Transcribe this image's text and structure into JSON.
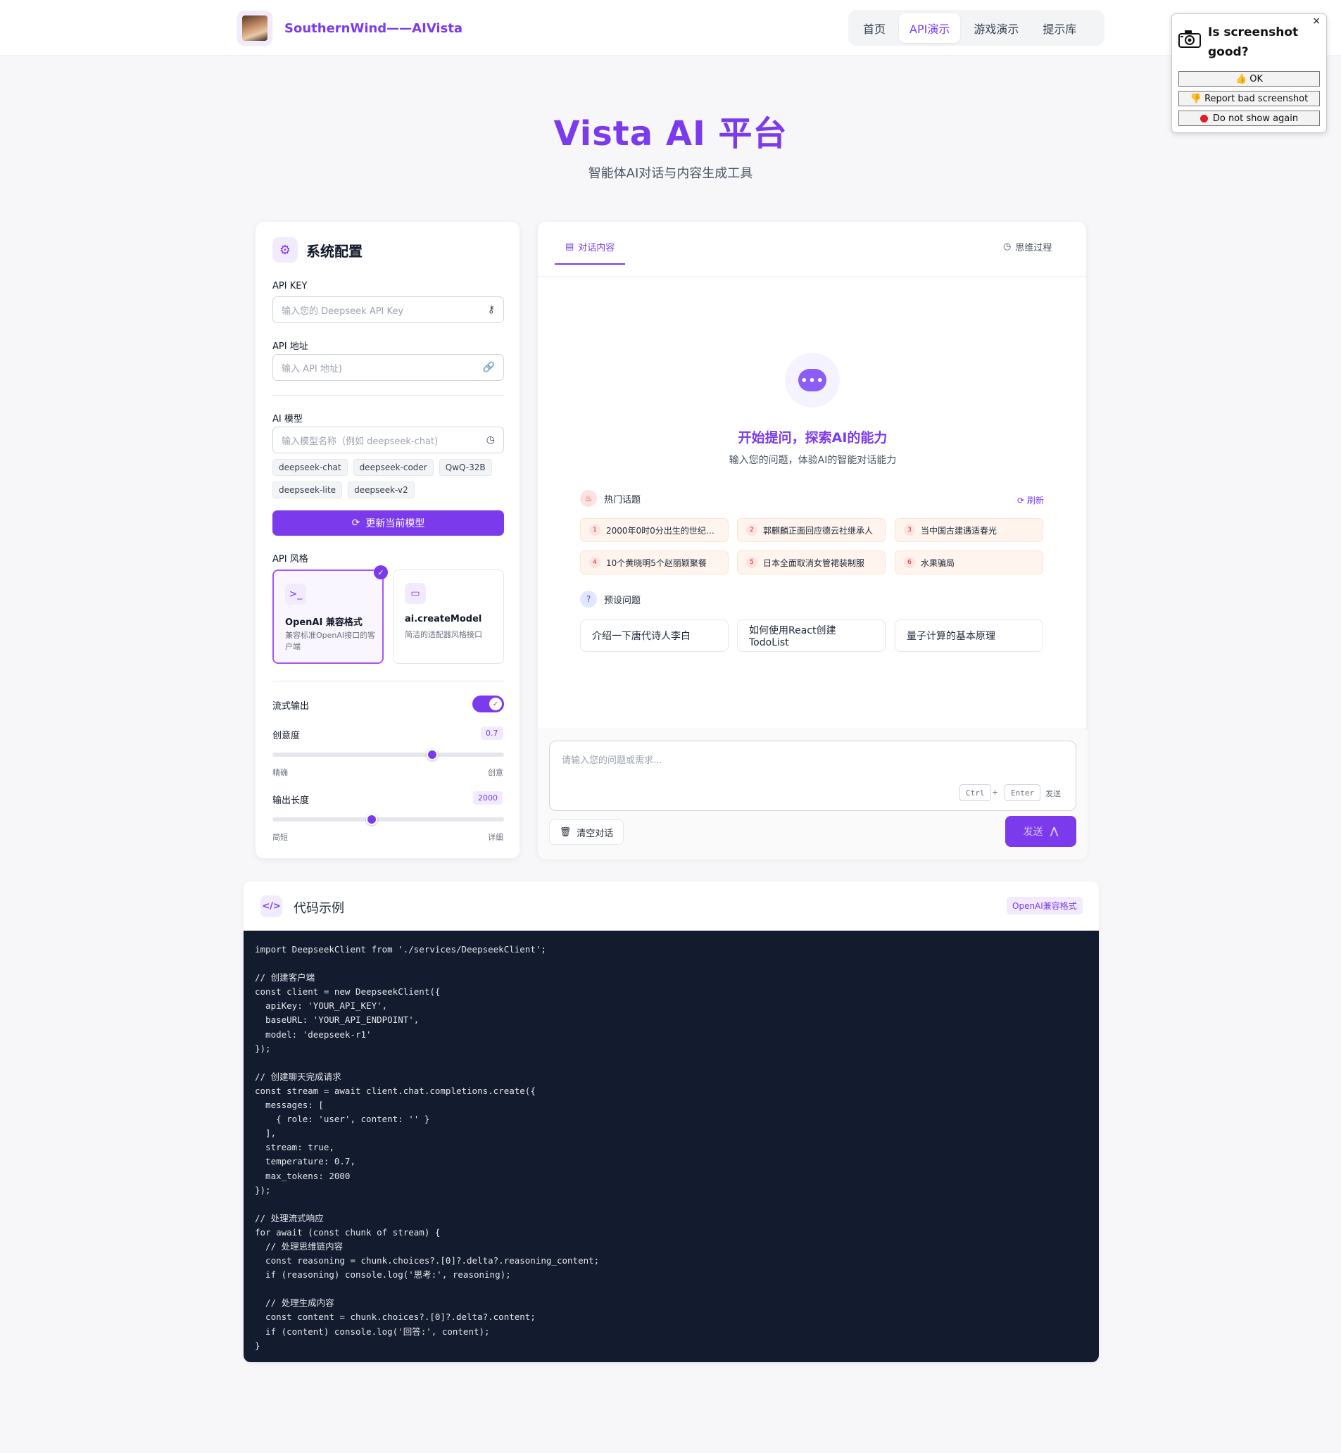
{
  "header": {
    "brand": "SouthernWind——AIVista",
    "nav": [
      "首页",
      "API演示",
      "游戏演示",
      "提示库"
    ],
    "active_nav": "API演示"
  },
  "popup": {
    "title": "Is screenshot good?",
    "ok": "👍 OK",
    "report": "👎 Report bad screenshot",
    "do_not_show": "Do not show again",
    "close": "×"
  },
  "hero": {
    "title": "Vista AI 平台",
    "subtitle": "智能体AI对话与内容生成工具"
  },
  "config": {
    "title": "系统配置",
    "api_key_label": "API KEY",
    "api_key_placeholder": "输入您的 Deepseek API Key",
    "api_url_label": "API 地址",
    "api_url_placeholder": "输入 API 地址)",
    "model_label": "AI 模型",
    "model_placeholder": "输入模型名称（例如 deepseek-chat)",
    "model_chips": [
      "deepseek-chat",
      "deepseek-coder",
      "QwQ-32B",
      "deepseek-lite",
      "deepseek-v2"
    ],
    "update_button": "更新当前模型",
    "api_style_label": "API 风格",
    "styles": [
      {
        "name": "OpenAI 兼容格式",
        "desc": "兼容标准OpenAI接口的客户端",
        "selected": true
      },
      {
        "name": "ai.createModel",
        "desc": "简洁的适配器风格接口",
        "selected": false
      }
    ],
    "stream_label": "流式输出",
    "stream_enabled": true,
    "creativity_label": "创意度",
    "creativity_value": "0.7",
    "creativity_fraction": 0.69,
    "creativity_min_label": "精确",
    "creativity_max_label": "创意",
    "length_label": "输出长度",
    "length_value": "2000",
    "length_fraction": 0.43,
    "length_min_label": "简短",
    "length_max_label": "详细"
  },
  "chat": {
    "tab_dialog": "对话内容",
    "tab_thinking": "思维过程",
    "empty_title": "开始提问，探索AI的能力",
    "empty_subtitle": "输入您的问题，体验AI的智能对话能力",
    "hot_title": "热门话题",
    "refresh": "刷新",
    "hot_topics": [
      {
        "n": "1",
        "text": "2000年0时0分出生的世纪婴..."
      },
      {
        "n": "2",
        "text": "郭麒麟正面回应德云社继承人"
      },
      {
        "n": "3",
        "text": "当中国古建遇适春光"
      },
      {
        "n": "4",
        "text": "10个黄晓明5个赵丽颖聚餐"
      },
      {
        "n": "5",
        "text": "日本全面取消女管裙装制服"
      },
      {
        "n": "6",
        "text": "水果骗局"
      }
    ],
    "preset_title": "预设问题",
    "presets": [
      "介绍一下唐代诗人李白",
      "如何使用React创建TodoList",
      "量子计算的基本原理"
    ],
    "input_placeholder": "请输入您的问题或需求...",
    "kbd_ctrl": "Ctrl",
    "kbd_plus": "+",
    "kbd_enter": "Enter",
    "kbd_send": "发送",
    "clear_button": "清空对话",
    "send_button": "发送"
  },
  "code": {
    "title": "代码示例",
    "tag": "OpenAI兼容格式",
    "snippet": "import DeepseekClient from './services/DeepseekClient';\n\n// 创建客户端\nconst client = new DeepseekClient({\n  apiKey: 'YOUR_API_KEY',\n  baseURL: 'YOUR_API_ENDPOINT',\n  model: 'deepseek-r1'\n});\n\n// 创建聊天完成请求\nconst stream = await client.chat.completions.create({\n  messages: [\n    { role: 'user', content: '' }\n  ],\n  stream: true,\n  temperature: 0.7,\n  max_tokens: 2000\n});\n\n// 处理流式响应\nfor await (const chunk of stream) {\n  // 处理思维链内容\n  const reasoning = chunk.choices?.[0]?.delta?.reasoning_content;\n  if (reasoning) console.log('思考:', reasoning);\n\n  // 处理生成内容\n  const content = chunk.choices?.[0]?.delta?.content;\n  if (content) console.log('回答:', content);\n}"
  },
  "colors": {
    "accent": "#7c3aed",
    "code_bg": "#131b2e",
    "hot_bg": "#fff4ee"
  }
}
